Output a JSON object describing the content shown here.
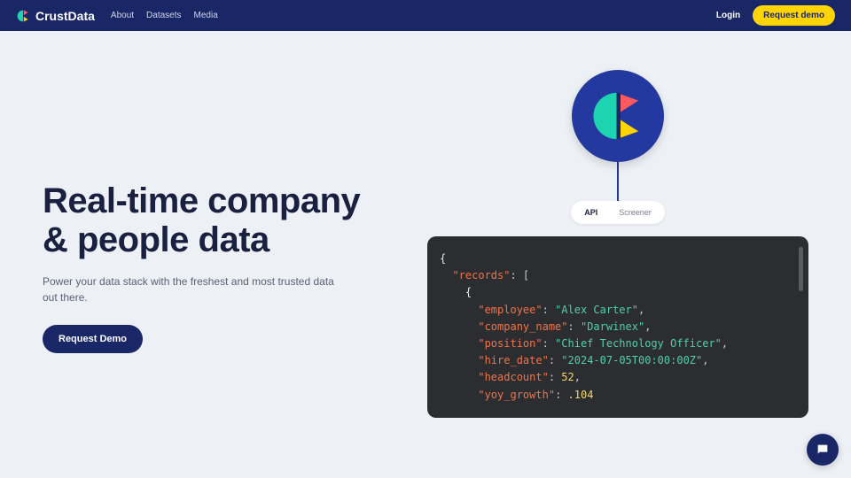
{
  "header": {
    "brand": "CrustData",
    "nav": [
      "About",
      "Datasets",
      "Media"
    ],
    "login": "Login",
    "demo": "Request demo"
  },
  "hero": {
    "headline_l1": "Real-time company",
    "headline_l2": "& people data",
    "subtext": "Power your data stack with the freshest and most trusted data out there.",
    "cta": "Request Demo"
  },
  "tabs": {
    "api": "API",
    "screener": "Screener"
  },
  "code": {
    "l1": "{",
    "l2_key": "\"records\"",
    "l2_rest": ": [",
    "l3": "    {",
    "l4_key": "\"employee\"",
    "l4_val": "\"Alex Carter\"",
    "l5_key": "\"company_name\"",
    "l5_val": "\"Darwinex\"",
    "l6_key": "\"position\"",
    "l6_val": "\"Chief Technology Officer\"",
    "l7_key": "\"hire_date\"",
    "l7_val": "\"2024-07-05T00:00:00Z\"",
    "l8_key": "\"headcount\"",
    "l8_val": "52",
    "l9_key": "\"yoy_growth\"",
    "l9_val": ".104"
  }
}
